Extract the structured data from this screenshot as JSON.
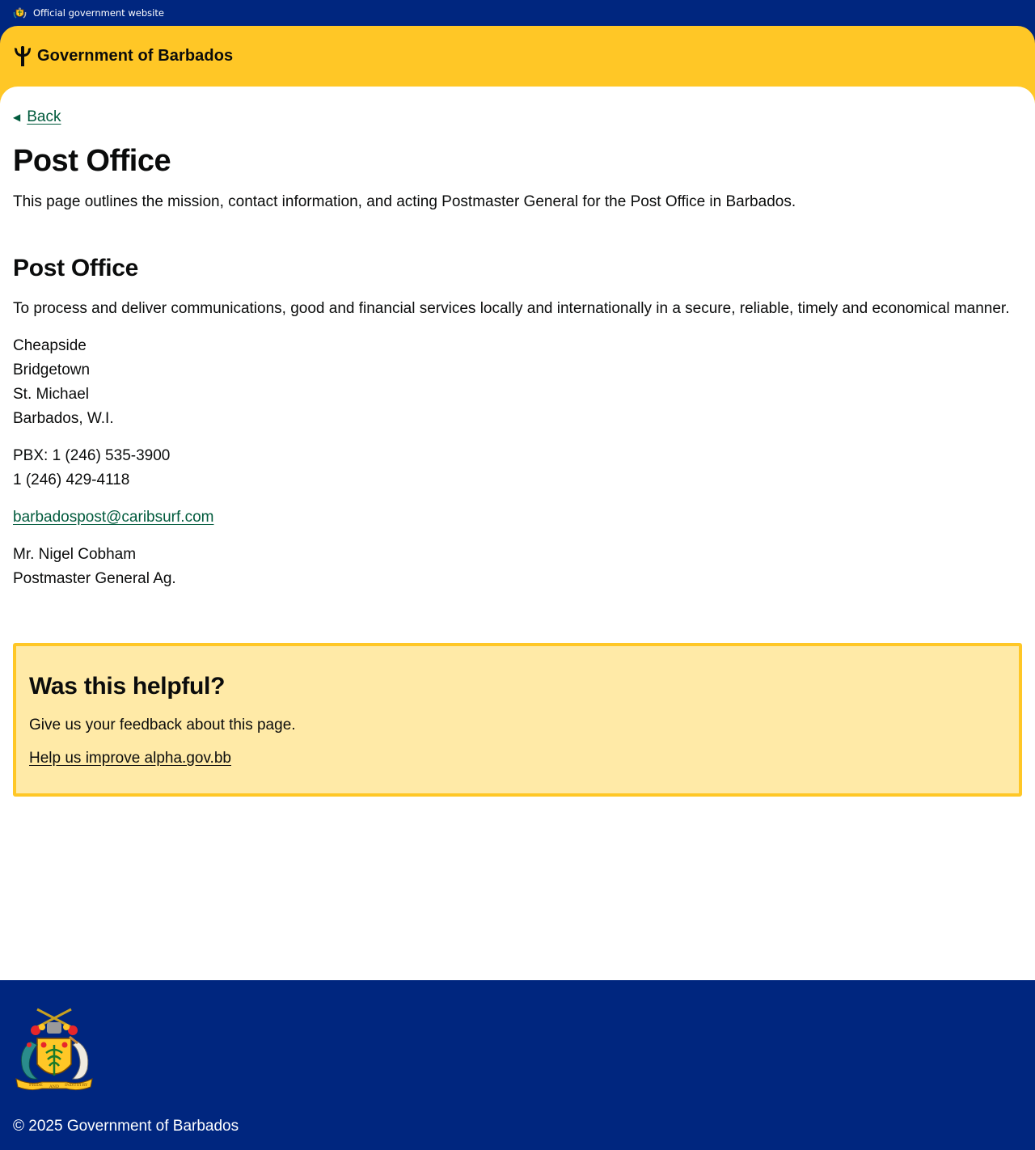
{
  "topbar": {
    "label": "Official government website"
  },
  "header": {
    "brand": "Government of Barbados"
  },
  "nav": {
    "back_label": "Back"
  },
  "page": {
    "title": "Post Office",
    "lead": "This page outlines the mission, contact information, and acting Postmaster General for the Post Office in Barbados."
  },
  "section": {
    "heading": "Post Office",
    "mission": "To process and deliver communications, good and financial services locally and internationally in a secure, reliable, timely and economical manner.",
    "address": [
      "Cheapside",
      "Bridgetown",
      "St. Michael",
      "Barbados, W.I."
    ],
    "phones": [
      "PBX: 1 (246) 535-3900",
      "1 (246) 429-4118"
    ],
    "email": "barbadospost@caribsurf.com",
    "contact_name": "Mr. Nigel Cobham",
    "contact_title": "Postmaster General Ag."
  },
  "feedback": {
    "heading": "Was this helpful?",
    "text": "Give us your feedback about this page.",
    "link": "Help us improve alpha.gov.bb"
  },
  "footer": {
    "copyright": "© 2025 Government of Barbados",
    "crest_motto": [
      "PRIDE",
      "AND",
      "INDUSTRY"
    ]
  },
  "colors": {
    "navy": "#00267f",
    "gold": "#ffc726",
    "feedback_bg": "#ffeaa7",
    "link_green": "#005a3c"
  }
}
